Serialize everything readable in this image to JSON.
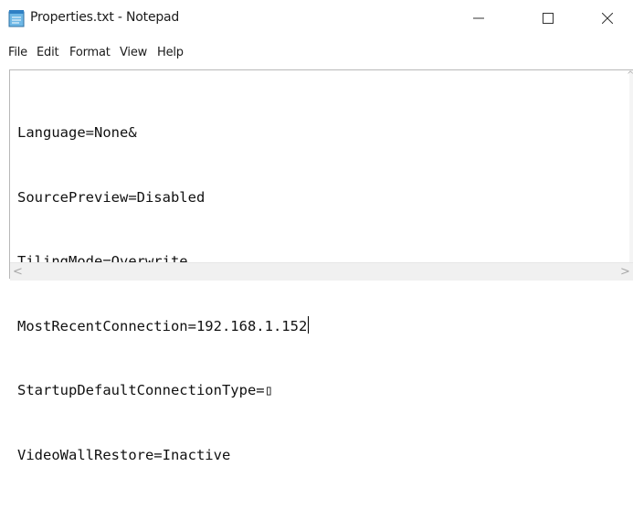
{
  "window": {
    "title": "Properties.txt - Notepad",
    "icon": "notepad-icon",
    "controls": {
      "minimize_icon": "minimize-icon",
      "maximize_icon": "maximize-icon",
      "close_icon": "close-icon"
    }
  },
  "menu": {
    "items": [
      "File",
      "Edit",
      "Format",
      "View",
      "Help"
    ]
  },
  "editor": {
    "lines": [
      "Language=None&",
      "SourcePreview=Disabled",
      "TilingMode=Overwrite",
      "MostRecentConnection=192.168.1.152",
      "StartupDefaultConnectionType=▯",
      "VideoWallRestore=Inactive"
    ]
  },
  "scrollbars": {
    "left_arrow": "<",
    "right_arrow": ">"
  },
  "colors": {
    "background": "#ffffff",
    "text": "#111111",
    "border": "#b8b8b8"
  }
}
